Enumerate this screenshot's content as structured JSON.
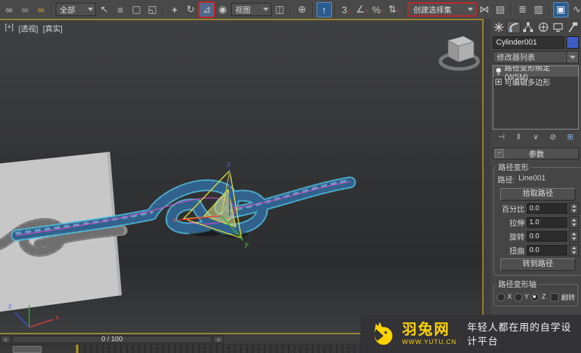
{
  "toolbar": {
    "icons": [
      {
        "name": "select-and-link",
        "glyph": "∞"
      },
      {
        "name": "unlink-selection",
        "glyph": "∞"
      },
      {
        "name": "bind-to-space-warp",
        "glyph": "∞"
      },
      {
        "name": "selection-filter",
        "value": "全部"
      },
      {
        "name": "select-object",
        "glyph": "↖"
      },
      {
        "name": "select-by-name",
        "glyph": "≡"
      },
      {
        "name": "rectangular-selection-region",
        "glyph": "▢"
      },
      {
        "name": "window-crossing",
        "glyph": "◱"
      },
      {
        "name": "select-and-move",
        "glyph": "+"
      },
      {
        "name": "select-and-rotate",
        "glyph": "↻"
      },
      {
        "name": "select-and-scale",
        "glyph": "⊿"
      },
      {
        "name": "use-pivot-point-center",
        "glyph": "◉"
      },
      {
        "name": "reference-coordinate-system",
        "value": "视图"
      },
      {
        "name": "pivot-point",
        "glyph": "◫"
      },
      {
        "name": "select-and-manipulate",
        "glyph": "⊕"
      },
      {
        "name": "keyboard-shortcut-override",
        "glyph": "↑"
      },
      {
        "name": "snap-toggle-3d",
        "glyph": "3",
        "magnet": "∩"
      },
      {
        "name": "angle-snap",
        "glyph": "∠",
        "magnet": "∩"
      },
      {
        "name": "percent-snap",
        "glyph": "%",
        "magnet": "∩"
      },
      {
        "name": "spinner-snap",
        "glyph": "⇅",
        "magnet": "∩"
      },
      {
        "name": "named-selection-sets",
        "value": "创建选择集"
      },
      {
        "name": "mirror",
        "glyph": "⋈"
      },
      {
        "name": "align",
        "glyph": "▤"
      },
      {
        "name": "layer-manager",
        "glyph": "≣"
      },
      {
        "name": "ribbon-toggle",
        "glyph": "▥"
      },
      {
        "name": "scene-explorer",
        "glyph": "▣"
      },
      {
        "name": "curve-editor",
        "glyph": "∿"
      },
      {
        "name": "schematic-view",
        "glyph": "▦"
      }
    ]
  },
  "viewport": {
    "menu_general": "[+]",
    "menu_pov": "[透视]",
    "menu_shading": "[真实]",
    "gizmo_axis": {
      "x": "x",
      "y": "y",
      "z": "z"
    },
    "world_axis": {
      "x": "x",
      "z": "z"
    }
  },
  "right_panel": {
    "object_name": "Cylinder001",
    "modifier_list_label": "修改器列表",
    "stack": [
      {
        "label": "路径变形绑定 (WSM)"
      },
      {
        "label": "可编辑多边形"
      }
    ],
    "stack_buttons": [
      {
        "name": "pin-stack",
        "glyph": "⊣"
      },
      {
        "name": "show-end-result",
        "glyph": "‖"
      },
      {
        "name": "make-unique",
        "glyph": "∨"
      },
      {
        "name": "remove-modifier",
        "glyph": "⊘"
      },
      {
        "name": "configure-modifier-sets",
        "glyph": "⊞"
      }
    ],
    "rollout": {
      "collapse_glyph": "−",
      "title": "参数",
      "path_deform": {
        "title": "路径变形",
        "path_label": "路径:",
        "path_value": "Line001",
        "pick_path_button": "拾取路径",
        "spinners": [
          {
            "label": "百分比",
            "value": "0.0"
          },
          {
            "label": "拉伸",
            "value": "1.0"
          },
          {
            "label": "旋转",
            "value": "0.0"
          },
          {
            "label": "扭曲",
            "value": "0.0"
          }
        ],
        "goto_path_button": "转到路径"
      },
      "axis_group": {
        "title": "路径变形轴",
        "options": [
          {
            "label": "X",
            "selected": false
          },
          {
            "label": "Y",
            "selected": false
          },
          {
            "label": "Z",
            "selected": true
          }
        ],
        "flip_label": "翻转"
      }
    }
  },
  "timeline": {
    "prev": "<",
    "frame_display": "0 / 100",
    "next": ">"
  },
  "watermark": {
    "brand": "羽兔网",
    "url": "WWW.YUTU.CN",
    "slogan": "年轻人都在用的自学设计平台"
  },
  "colors": {
    "active_viewport_border": "#9c852b",
    "annotation_red": "#c42525",
    "object_color": "#3b5cc4",
    "rope_blue": "#4a7fae",
    "watermark_yellow": "#ffd400"
  }
}
